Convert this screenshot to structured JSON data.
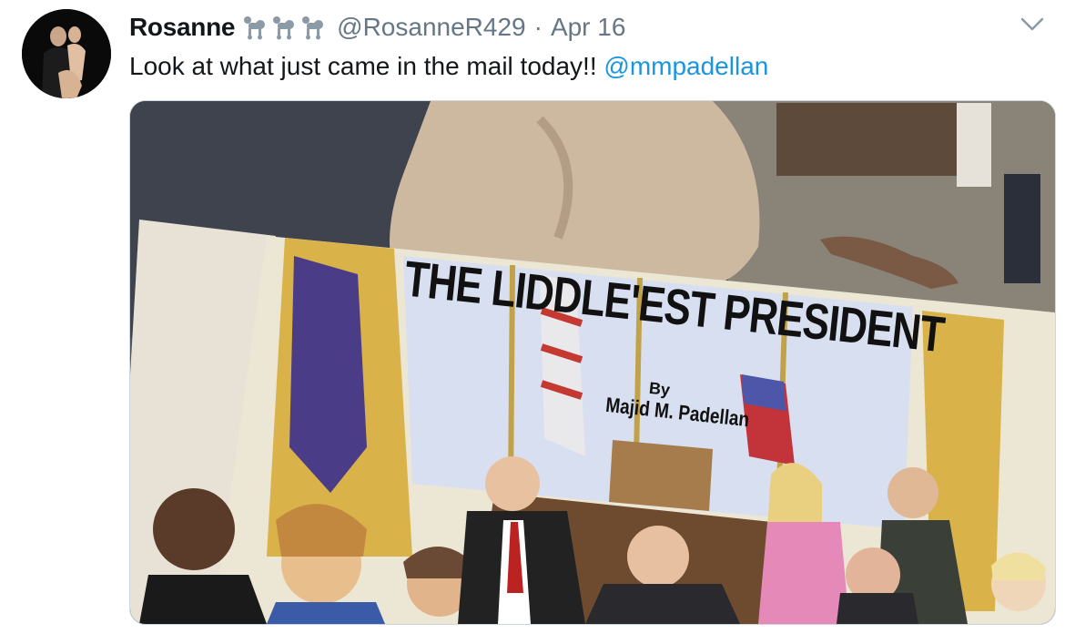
{
  "tweet": {
    "display_name": "Rosanne",
    "handle": "@RosanneR429",
    "separator": "·",
    "date": "Apr 16",
    "name_emoji": [
      "poodle-icon",
      "poodle-icon",
      "poodle-icon"
    ],
    "text_before_mention": "Look at what just came in the mail today!! ",
    "mention": "@mmpadellan",
    "menu_icon": "chevron-down-icon"
  },
  "media": {
    "book_title": "THE LIDDLE'EST PRESIDENT",
    "book_by": "By",
    "book_author": "Majid M. Padellan"
  },
  "colors": {
    "link": "#1b95e0",
    "secondary_text": "#657786",
    "border": "#ccd6dd"
  }
}
